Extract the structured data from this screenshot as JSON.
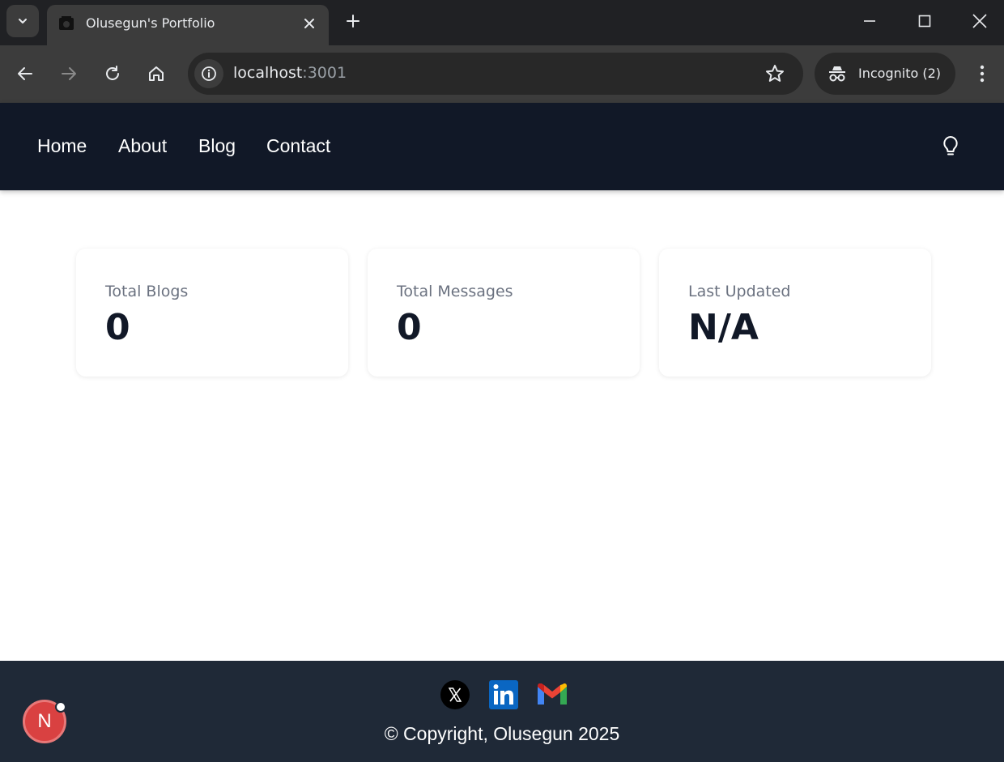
{
  "browser": {
    "tab_title": "Olusegun's Portfolio",
    "url_host": "localhost",
    "url_port": ":3001",
    "profile_label": "Incognito (2)"
  },
  "nav": {
    "links": [
      "Home",
      "About",
      "Blog",
      "Contact"
    ]
  },
  "stats": [
    {
      "label": "Total Blogs",
      "value": "0"
    },
    {
      "label": "Total Messages",
      "value": "0"
    },
    {
      "label": "Last Updated",
      "value": "N/A"
    }
  ],
  "footer": {
    "copyright": "© Copyright, Olusegun 2025",
    "social_icons": [
      "x-icon",
      "linkedin-icon",
      "gmail-icon"
    ]
  },
  "dev_badge": {
    "letter": "N"
  },
  "colors": {
    "nav_bg": "#111827",
    "footer_bg": "#1f2937",
    "badge_red": "#d94141"
  }
}
